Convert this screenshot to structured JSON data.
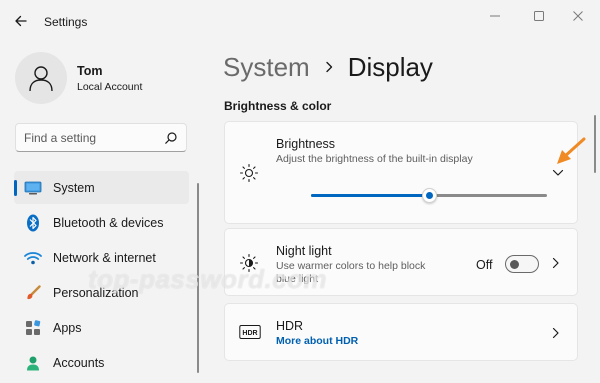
{
  "app": {
    "title": "Settings"
  },
  "window_controls": {
    "minimize_icon": "minimize-icon",
    "maximize_icon": "maximize-icon",
    "close_icon": "close-icon"
  },
  "profile": {
    "name": "Tom",
    "account_type": "Local Account"
  },
  "search": {
    "placeholder": "Find a setting"
  },
  "sidebar": {
    "items": [
      {
        "label": "System",
        "icon": "monitor-icon",
        "active": true
      },
      {
        "label": "Bluetooth & devices",
        "icon": "bluetooth-icon",
        "active": false
      },
      {
        "label": "Network & internet",
        "icon": "wifi-icon",
        "active": false
      },
      {
        "label": "Personalization",
        "icon": "brush-icon",
        "active": false
      },
      {
        "label": "Apps",
        "icon": "apps-icon",
        "active": false
      },
      {
        "label": "Accounts",
        "icon": "person-icon",
        "active": false
      }
    ]
  },
  "breadcrumb": {
    "parent": "System",
    "current": "Display"
  },
  "section": {
    "heading": "Brightness & color"
  },
  "brightness": {
    "title": "Brightness",
    "description": "Adjust the brightness of the built-in display",
    "value_fraction": 0.5
  },
  "night_light": {
    "title": "Night light",
    "description_line1": "Use warmer colors to help block",
    "description_line2": "blue light",
    "state_label": "Off",
    "on": false
  },
  "hdr": {
    "title": "HDR",
    "link": "More about HDR"
  },
  "watermark": "top-password.com",
  "colors": {
    "accent": "#0067c0",
    "annotation_arrow": "#f08a24",
    "background": "#f3f3f3",
    "card": "#fbfbfb"
  }
}
